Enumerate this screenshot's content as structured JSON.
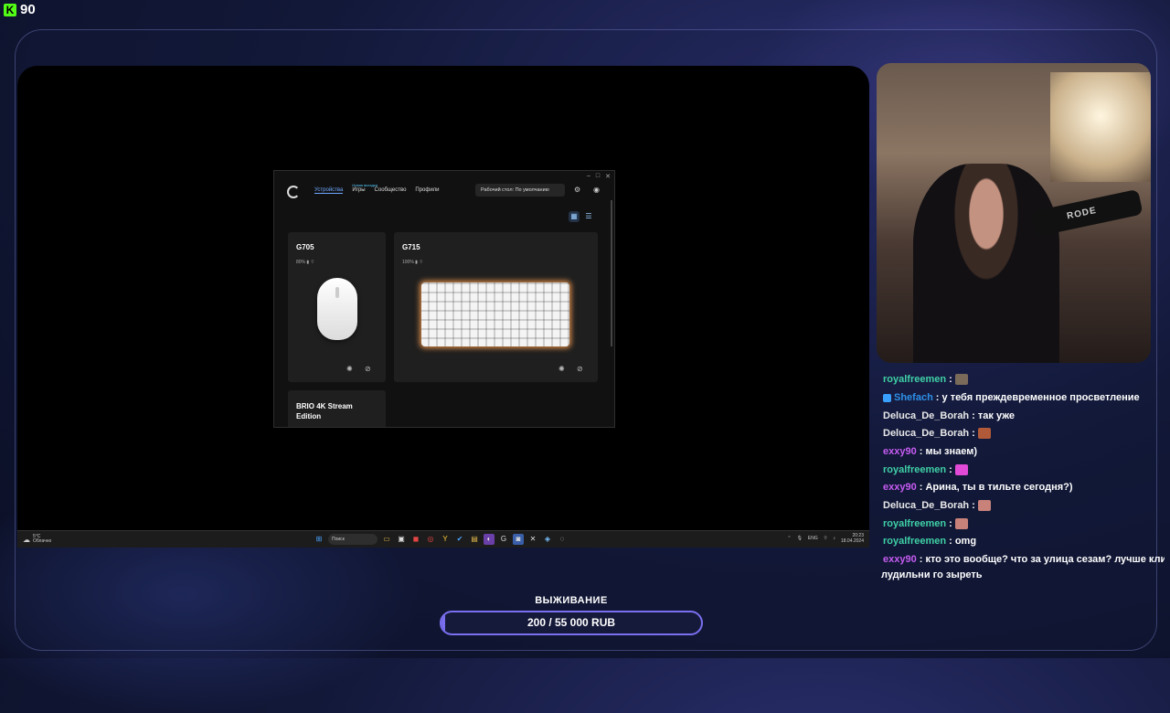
{
  "kick": {
    "viewer_count": "90"
  },
  "ghub": {
    "window_controls": [
      "–",
      "□",
      "✕"
    ],
    "nav": {
      "devices": "Устройства",
      "games": "Игры",
      "games_badge": "Новая вкладка",
      "community": "Сообщество",
      "profiles": "Профили"
    },
    "profile_selector": "Рабочий стол: По умолчанию",
    "devices": [
      {
        "name": "G705",
        "battery": "80% ▮ ⌔"
      },
      {
        "name": "G715",
        "battery": "100% ▮ ⌔"
      },
      {
        "name": "BRIO 4K Stream Edition"
      }
    ]
  },
  "taskbar": {
    "weather_temp": "5°C",
    "weather_desc": "Облачно",
    "search_placeholder": "Поиск",
    "lang": "ENG",
    "time": "20:23",
    "date": "18.04.2024"
  },
  "cam": {
    "mic_brand": "RODE"
  },
  "chat": {
    "messages": [
      {
        "user": "royalfreemen",
        "color": "#3fd0a6",
        "text": ":",
        "emote": "#7a6a5a"
      },
      {
        "user": "Shefach",
        "color": "#2e8fe8",
        "text": ": у тебя преждевременное просветление"
      },
      {
        "user": "Deluca_De_Borah",
        "color": "#e8e8e8",
        "text": ": так уже"
      },
      {
        "user": "Deluca_De_Borah",
        "color": "#e8e8e8",
        "text": ":",
        "emote": "#b05a3a"
      },
      {
        "user": "exxy90",
        "color": "#c65cf2",
        "text": ": мы знаем)"
      },
      {
        "user": "royalfreemen",
        "color": "#3fd0a6",
        "text": ":",
        "emote": "#e04ad6"
      },
      {
        "user": "exxy90",
        "color": "#c65cf2",
        "text": ": Арина, ты в тильте сегодня?)"
      },
      {
        "user": "Deluca_De_Borah",
        "color": "#e8e8e8",
        "text": ":",
        "emote": "#c9827a"
      },
      {
        "user": "royalfreemen",
        "color": "#3fd0a6",
        "text": ":",
        "emote": "#c9827a"
      },
      {
        "user": "royalfreemen",
        "color": "#3fd0a6",
        "text": ": omg"
      },
      {
        "user": "exxy90",
        "color": "#c65cf2",
        "text": ": кто это вообще? что за улица сезам? лучше клип с"
      }
    ],
    "wrap_line": "лудильни го зыреть"
  },
  "goal": {
    "title": "ВЫЖИВАНИЕ",
    "amount": "200 / 55 000 RUB",
    "progress": 0.0036,
    "accent": "#7a6ff0"
  }
}
